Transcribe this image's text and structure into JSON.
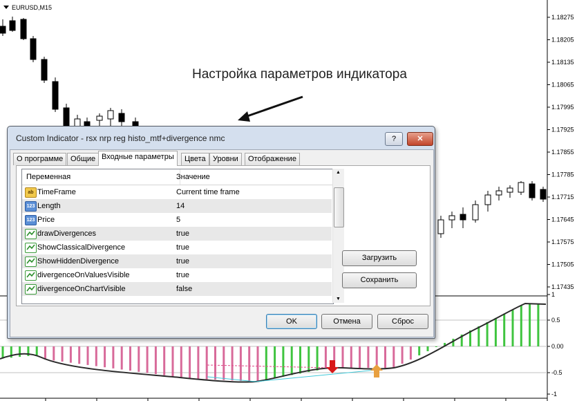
{
  "chart": {
    "symbol_label": "EURUSD,M15",
    "price_axis": [
      "1.18275",
      "1.18205",
      "1.18135",
      "1.18065",
      "1.17995",
      "1.17925",
      "1.17855",
      "1.17785",
      "1.17715",
      "1.17645",
      "1.17575",
      "1.17505",
      "1.17435"
    ],
    "indicator_axis": [
      "1",
      "0.5",
      "0.00",
      "-0.5",
      "-1"
    ],
    "annotation": "Настройка параметров индикатора",
    "colors": {
      "bull_bar": "#3fc43f",
      "bear_bar": "#d86a9a",
      "divergence_line": "#40c8d8",
      "buy_arrow": "#e8a040",
      "sell_arrow": "#d81818"
    }
  },
  "dialog": {
    "title": "Custom Indicator - rsx nrp reg histo_mtf+divergence nmc",
    "help_label": "?",
    "close_icon": "close-icon",
    "tabs": [
      "О программе",
      "Общие",
      "Входные параметры",
      "Цвета",
      "Уровни",
      "Отображение"
    ],
    "active_tab": "Входные параметры",
    "grid": {
      "col_name": "Переменная",
      "col_value": "Значение",
      "rows": [
        {
          "type": "string",
          "icon_text": "ab",
          "name": "TimeFrame",
          "value": "Current time frame"
        },
        {
          "type": "int",
          "icon_text": "123",
          "name": "Length",
          "value": "14"
        },
        {
          "type": "int",
          "icon_text": "123",
          "name": "Price",
          "value": "5"
        },
        {
          "type": "bool",
          "icon_text": "",
          "name": "drawDivergences",
          "value": "true"
        },
        {
          "type": "bool",
          "icon_text": "",
          "name": "ShowClassicalDivergence",
          "value": "true"
        },
        {
          "type": "bool",
          "icon_text": "",
          "name": "ShowHiddenDivergence",
          "value": "true"
        },
        {
          "type": "bool",
          "icon_text": "",
          "name": "divergenceOnValuesVisible",
          "value": "true"
        },
        {
          "type": "bool",
          "icon_text": "",
          "name": "divergenceOnChartVisible",
          "value": "false"
        }
      ]
    },
    "side_buttons": {
      "load": "Загрузить",
      "save": "Сохранить"
    },
    "footer_buttons": {
      "ok": "OK",
      "cancel": "Отмена",
      "reset": "Сброс"
    }
  }
}
